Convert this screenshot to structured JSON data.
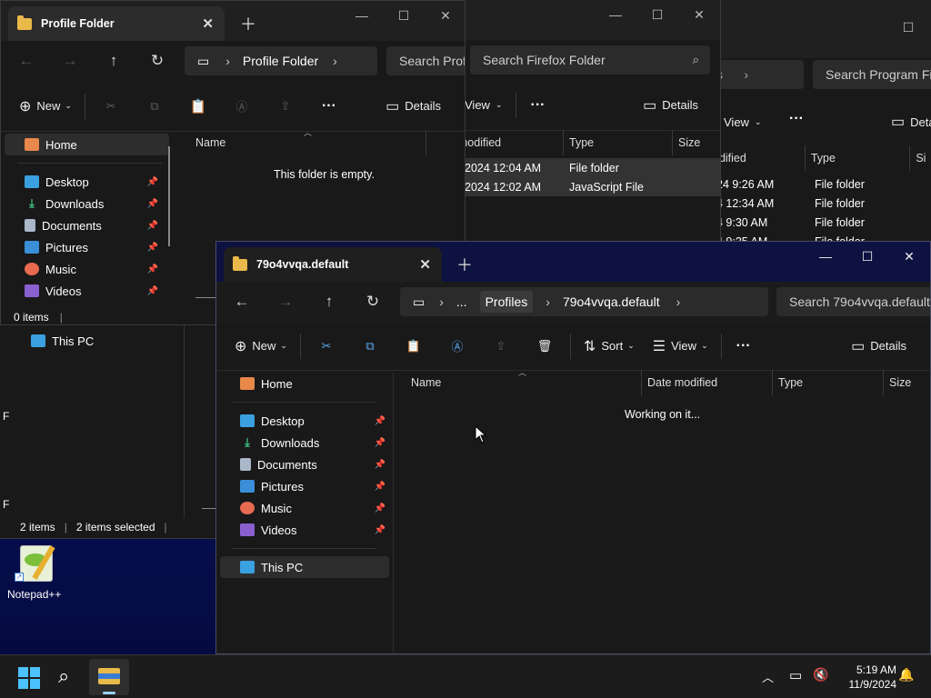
{
  "desktop": {
    "notepad_label": "Notepad++"
  },
  "win_back": {
    "search": "Search Program Fil",
    "view_label": "View",
    "details_label": "Details",
    "cols": {
      "modified": "odified",
      "type": "Type",
      "size": "Si"
    },
    "rows": [
      {
        "date": "24 9:26 AM",
        "type": "File folder"
      },
      {
        "date": "4 12:34 AM",
        "type": "File folder"
      },
      {
        "date": "4 9:30 AM",
        "type": "File folder"
      },
      {
        "date": "4 9:25 AM",
        "type": "File folder"
      }
    ]
  },
  "win_firefox": {
    "search": "Search Firefox Folder",
    "view_label": "View",
    "details_label": "Details",
    "cols": {
      "modified": "Date modified",
      "type": "Type",
      "size": "Size"
    },
    "rows": [
      {
        "date": "2024 12:04 AM",
        "type": "File folder"
      },
      {
        "date": "2024 12:02 AM",
        "type": "JavaScript File"
      }
    ]
  },
  "win_profile": {
    "tab_title": "Profile Folder",
    "breadcrumb": "Profile Folder",
    "search": "Search Profi",
    "new_label": "New",
    "details_label": "Details",
    "col_name": "Name",
    "empty_text": "This folder is empty.",
    "status": "0 items",
    "nav": [
      {
        "label": "Home"
      },
      {
        "label": "Desktop"
      },
      {
        "label": "Downloads"
      },
      {
        "label": "Documents"
      },
      {
        "label": "Pictures"
      },
      {
        "label": "Music"
      },
      {
        "label": "Videos"
      }
    ]
  },
  "win_mid": {
    "this_pc": "This PC",
    "status_items": "2 items",
    "status_selected": "2 items selected",
    "letter1": "F",
    "letter2": "F"
  },
  "win_main": {
    "tab_title": "79o4vvqa.default",
    "breadcrumb": [
      "Profiles",
      "79o4vvqa.default"
    ],
    "ellipsis": "...",
    "search": "Search 79o4vvqa.default",
    "new_label": "New",
    "sort_label": "Sort",
    "view_label": "View",
    "details_label": "Details",
    "cols": {
      "name": "Name",
      "modified": "Date modified",
      "type": "Type",
      "size": "Size"
    },
    "working_text": "Working on it...",
    "nav": [
      {
        "label": "Home"
      },
      {
        "label": "Desktop"
      },
      {
        "label": "Downloads"
      },
      {
        "label": "Documents"
      },
      {
        "label": "Pictures"
      },
      {
        "label": "Music"
      },
      {
        "label": "Videos"
      },
      {
        "label": "This PC"
      }
    ]
  },
  "taskbar": {
    "time": "5:19 AM",
    "date": "11/9/2024"
  }
}
